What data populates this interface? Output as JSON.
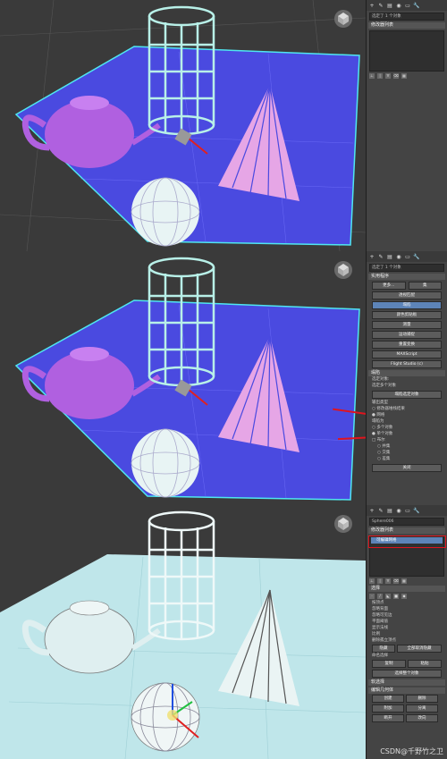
{
  "panels": [
    {
      "id": "f1",
      "field_value": "选定了 1 个对象",
      "rollout_title": "修改器列表",
      "list_items": []
    },
    {
      "id": "f2",
      "field_value": "选定了 1 个对象",
      "rollout_title": "实用程序",
      "top_buttons": [
        "更多...",
        "集"
      ],
      "utility_buttons": [
        "透视匹配",
        "塌陷",
        "颜色剪贴板",
        "测量",
        "运动捕捉",
        "重置变换",
        "MAXScript",
        "Flight Studio (c)"
      ],
      "collapse_title": "塌陷",
      "collapse_text1": "选定对象:",
      "collapse_text2": "选定多个对象",
      "collapse_btn": "塌陷选定对象",
      "output_title": "输出类型",
      "output_opt1": "修改器堆栈结果",
      "output_opt2": "网格",
      "collapse_to": "塌陷为",
      "collapse_opt1": "多个对象",
      "collapse_opt2": "单个对象",
      "boolean": "布尔",
      "bool_opt1": "并集",
      "bool_opt2": "交集",
      "bool_opt3": "差集",
      "close_btn": "关闭"
    },
    {
      "id": "f3",
      "field_value": "Sphere006",
      "rollout_title": "修改器列表",
      "list_items": [
        "可编辑网格"
      ],
      "sel_title": "选择",
      "sel_lines": [
        "按顶点",
        "忽略背面",
        "忽略可见边",
        "平面阈值",
        "显示法线",
        "比例",
        "删除孤立顶点",
        "隐藏",
        "全部取消隐藏",
        "命名选择",
        "复制",
        "粘贴",
        "选择整个对象"
      ],
      "soft_title": "软选择",
      "edit_title": "编辑几何体",
      "edit_btns": [
        "创建",
        "删除",
        "附加",
        "分离",
        "断开",
        "改向"
      ]
    }
  ],
  "watermark": "CSDN@千野竹之卫",
  "colors": {
    "grid_plane_purple": "#4a4ae0",
    "grid_plane_cyan": "#bfe6ea",
    "viewport_bg": "#3a3a3a",
    "teapot": "#b060e0",
    "cone": "#e6a6e6",
    "cylinder": "#b8f0e8",
    "sphere": "#e8f4f4",
    "highlight_blue": "#5d84b8",
    "annotation_red": "#e0141e"
  }
}
